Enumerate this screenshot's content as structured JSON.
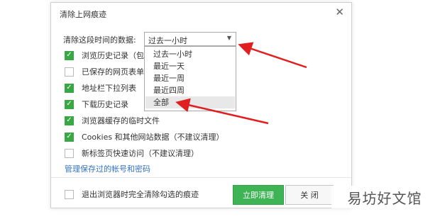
{
  "dialog": {
    "title": "清除上网痕迹",
    "close_icon": "close-icon",
    "time_range_label": "清除这段时间的数据:",
    "selected_range": "过去一小时",
    "range_options": [
      "过去一小时",
      "最近一天",
      "最近一周",
      "最近四周",
      "全部"
    ],
    "items": [
      {
        "label": "浏览历史记录（包含",
        "checked": true
      },
      {
        "label": "已保存的网页表单数",
        "checked": false
      },
      {
        "label": "地址栏下拉列表",
        "checked": true
      },
      {
        "label": "下载历史记录",
        "checked": true
      },
      {
        "label": "浏览器缓存的临时文件",
        "checked": true
      },
      {
        "label": "Cookies 和其他网站数据（不建议清理）",
        "checked": true
      },
      {
        "label": "新标签页快速访问（不建议清理）",
        "checked": false
      }
    ],
    "manage_link": "管理保存过的帐号和密码",
    "exit_clear": {
      "label": "退出浏览器时完全清除勾选的痕迹",
      "checked": false
    },
    "clear_button": "立即清理",
    "close_button": "关 闭"
  },
  "watermark": "易坊好文馆",
  "colors": {
    "green": "#3fb454",
    "checkbox_green": "#3aa745",
    "link": "#3473c4",
    "arrow": "#e02020"
  }
}
